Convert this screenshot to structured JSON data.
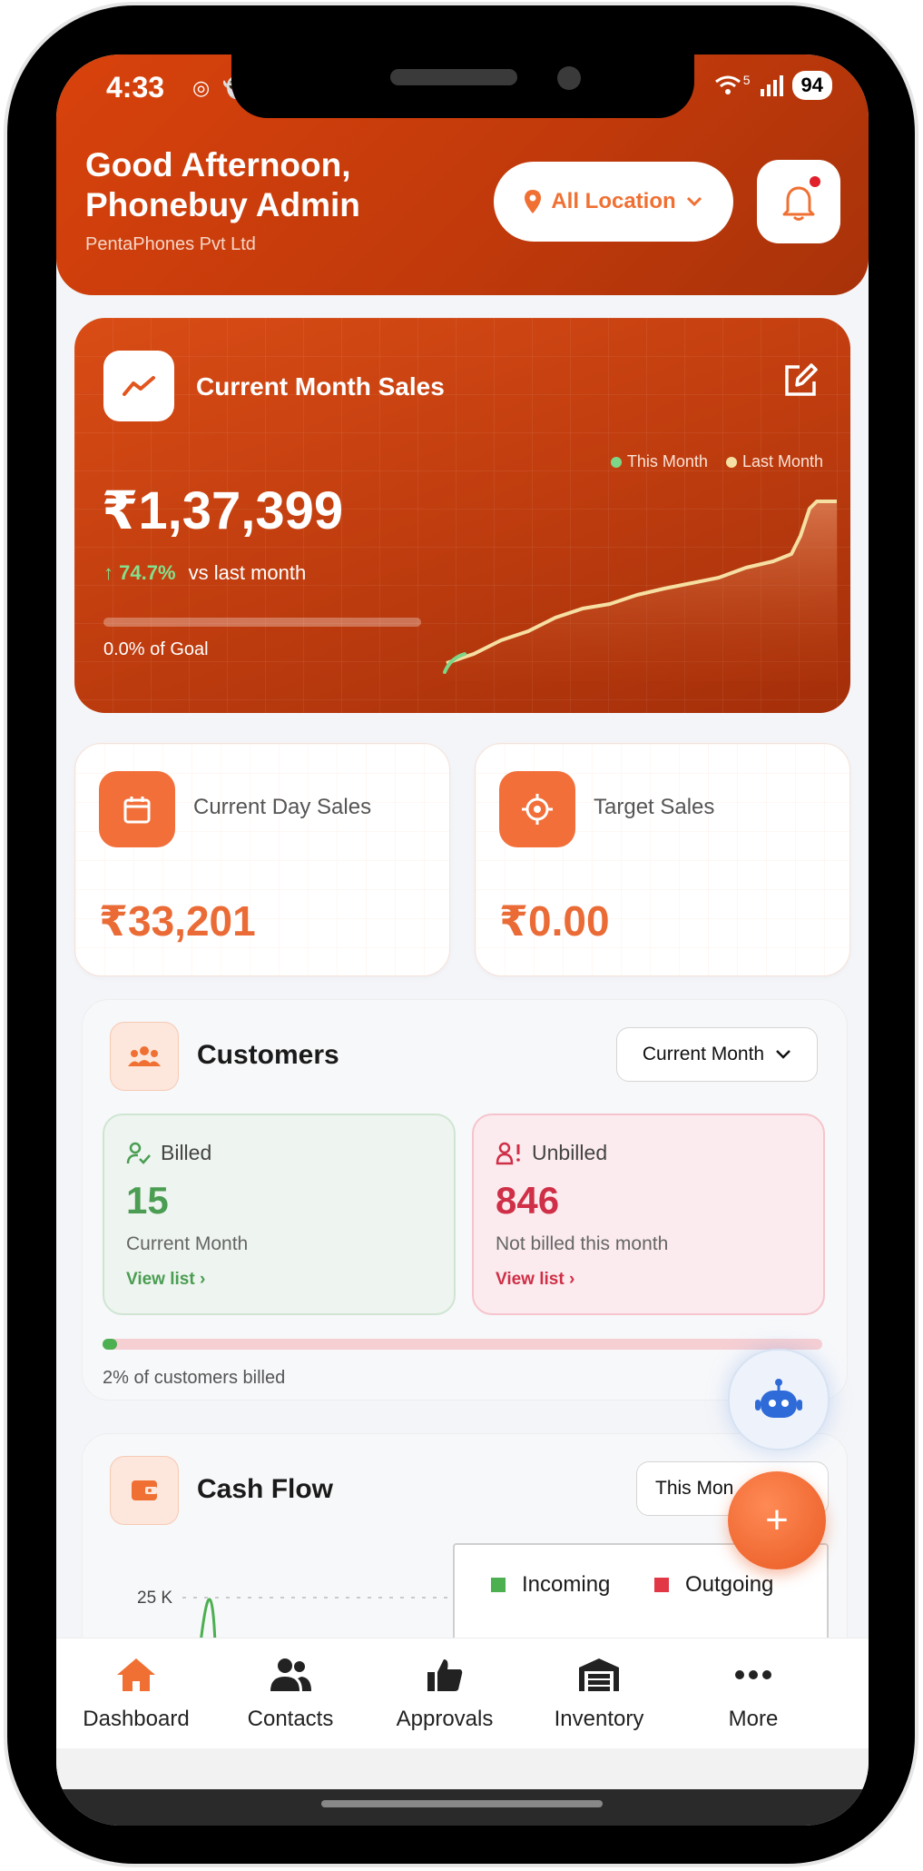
{
  "status_bar": {
    "time": "4:33",
    "battery": "94",
    "network": "5"
  },
  "header": {
    "greeting_line1": "Good Afternoon,",
    "greeting_line2": "Phonebuy Admin",
    "company": "PentaPhones Pvt Ltd",
    "location_label": "All Location"
  },
  "sales": {
    "title": "Current Month Sales",
    "amount": "₹1,37,399",
    "growth_pct": "74.7%",
    "growth_text": "vs last month",
    "goal_text": "0.0% of Goal",
    "goal_progress": 0.0,
    "legend": [
      {
        "label": "This Month",
        "color": "#7dd687"
      },
      {
        "label": "Last Month",
        "color": "#f6dfa2"
      }
    ]
  },
  "mini_cards": [
    {
      "label": "Current Day Sales",
      "value": "₹33,201",
      "icon": "calendar-icon"
    },
    {
      "label": "Target Sales",
      "value": "₹0.00",
      "icon": "target-icon"
    }
  ],
  "customers": {
    "title": "Customers",
    "period": "Current Month",
    "billed": {
      "label": "Billed",
      "count": "15",
      "sub": "Current Month",
      "link": "View list",
      "color": "#4a9d52"
    },
    "unbilled": {
      "label": "Unbilled",
      "count": "846",
      "sub": "Not billed this month",
      "link": "View list",
      "color": "#cf2f47"
    },
    "billed_fraction": 0.02,
    "note": "2% of customers billed"
  },
  "cash_flow": {
    "title": "Cash Flow",
    "period": "This Mon",
    "legend": [
      {
        "label": "Incoming",
        "color": "#4caf50"
      },
      {
        "label": "Outgoing",
        "color": "#e23744"
      }
    ],
    "y_tick": "25 K"
  },
  "fab": {
    "add_symbol": "+"
  },
  "nav": [
    {
      "label": "Dashboard",
      "icon": "home-icon",
      "active": true
    },
    {
      "label": "Contacts",
      "icon": "contacts-icon"
    },
    {
      "label": "Approvals",
      "icon": "thumbs-up-icon"
    },
    {
      "label": "Inventory",
      "icon": "warehouse-icon"
    },
    {
      "label": "More",
      "icon": "more-icon"
    }
  ]
}
